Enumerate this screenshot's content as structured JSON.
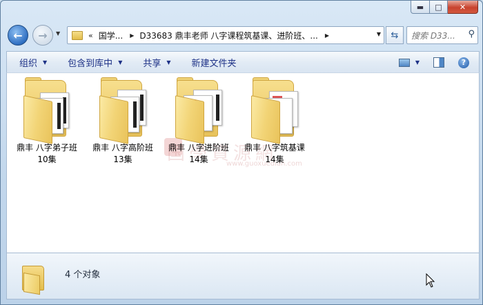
{
  "window": {
    "caption_buttons": {
      "minimize": "▬",
      "maximize": "□",
      "close": "✕"
    }
  },
  "address_bar": {
    "back_glyph": "←",
    "forward_glyph": "→",
    "history_dropdown_glyph": "▼",
    "overflow_chevron": "«",
    "separator_glyph": "▶",
    "crumbs": [
      "国学...",
      "D33683 鼎丰老师 八字课程筑基课、进阶班、..."
    ],
    "dropdown_glyph": "▼",
    "refresh_glyph": "⇆"
  },
  "search": {
    "placeholder": "搜索 D33...",
    "icon": "search-icon",
    "icon_glyph": "⚲"
  },
  "toolbar": {
    "organize": "组织",
    "include_in_library": "包含到库中",
    "share": "共享",
    "new_folder": "新建文件夹",
    "dropdown_glyph": "▼",
    "help_glyph": "?"
  },
  "folders": [
    {
      "name": "鼎丰 八字弟子班",
      "sub": "10集"
    },
    {
      "name": "鼎丰 八字高阶班",
      "sub": "13集"
    },
    {
      "name": "鼎丰 八字进阶班",
      "sub": "14集"
    },
    {
      "name": "鼎丰 八字筑基课",
      "sub": "14集"
    }
  ],
  "watermark": {
    "text": "国學資源網",
    "url": "www.guoxuedian.com"
  },
  "details": {
    "count_text": "4 个对象"
  }
}
